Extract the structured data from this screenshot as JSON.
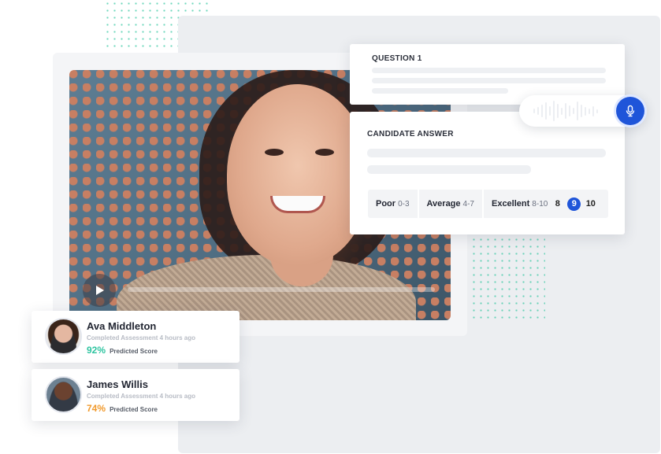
{
  "question": {
    "title": "QUESTION 1"
  },
  "answer": {
    "title": "CANDIDATE ANSWER",
    "ratings": [
      {
        "label": "Poor",
        "range": "0-3"
      },
      {
        "label": "Average",
        "range": "4-7"
      },
      {
        "label": "Excellent",
        "range": "8-10"
      }
    ],
    "scores": [
      "8",
      "9",
      "10"
    ],
    "selected_score": "9"
  },
  "candidates": [
    {
      "name": "Ava Middleton",
      "status": "Completed Assessment 4 hours ago",
      "score": "92%",
      "score_label": "Predicted Score"
    },
    {
      "name": "James Willis",
      "status": "Completed Assessment 4 hours ago",
      "score": "74%",
      "score_label": "Predicted Score"
    }
  ],
  "icons": {
    "play": "play-icon",
    "mic": "microphone-icon"
  },
  "colors": {
    "accent": "#1f55d9",
    "score_high": "#2ec4a0",
    "score_mid": "#f19a2d",
    "dots": "#3fc9a5"
  }
}
